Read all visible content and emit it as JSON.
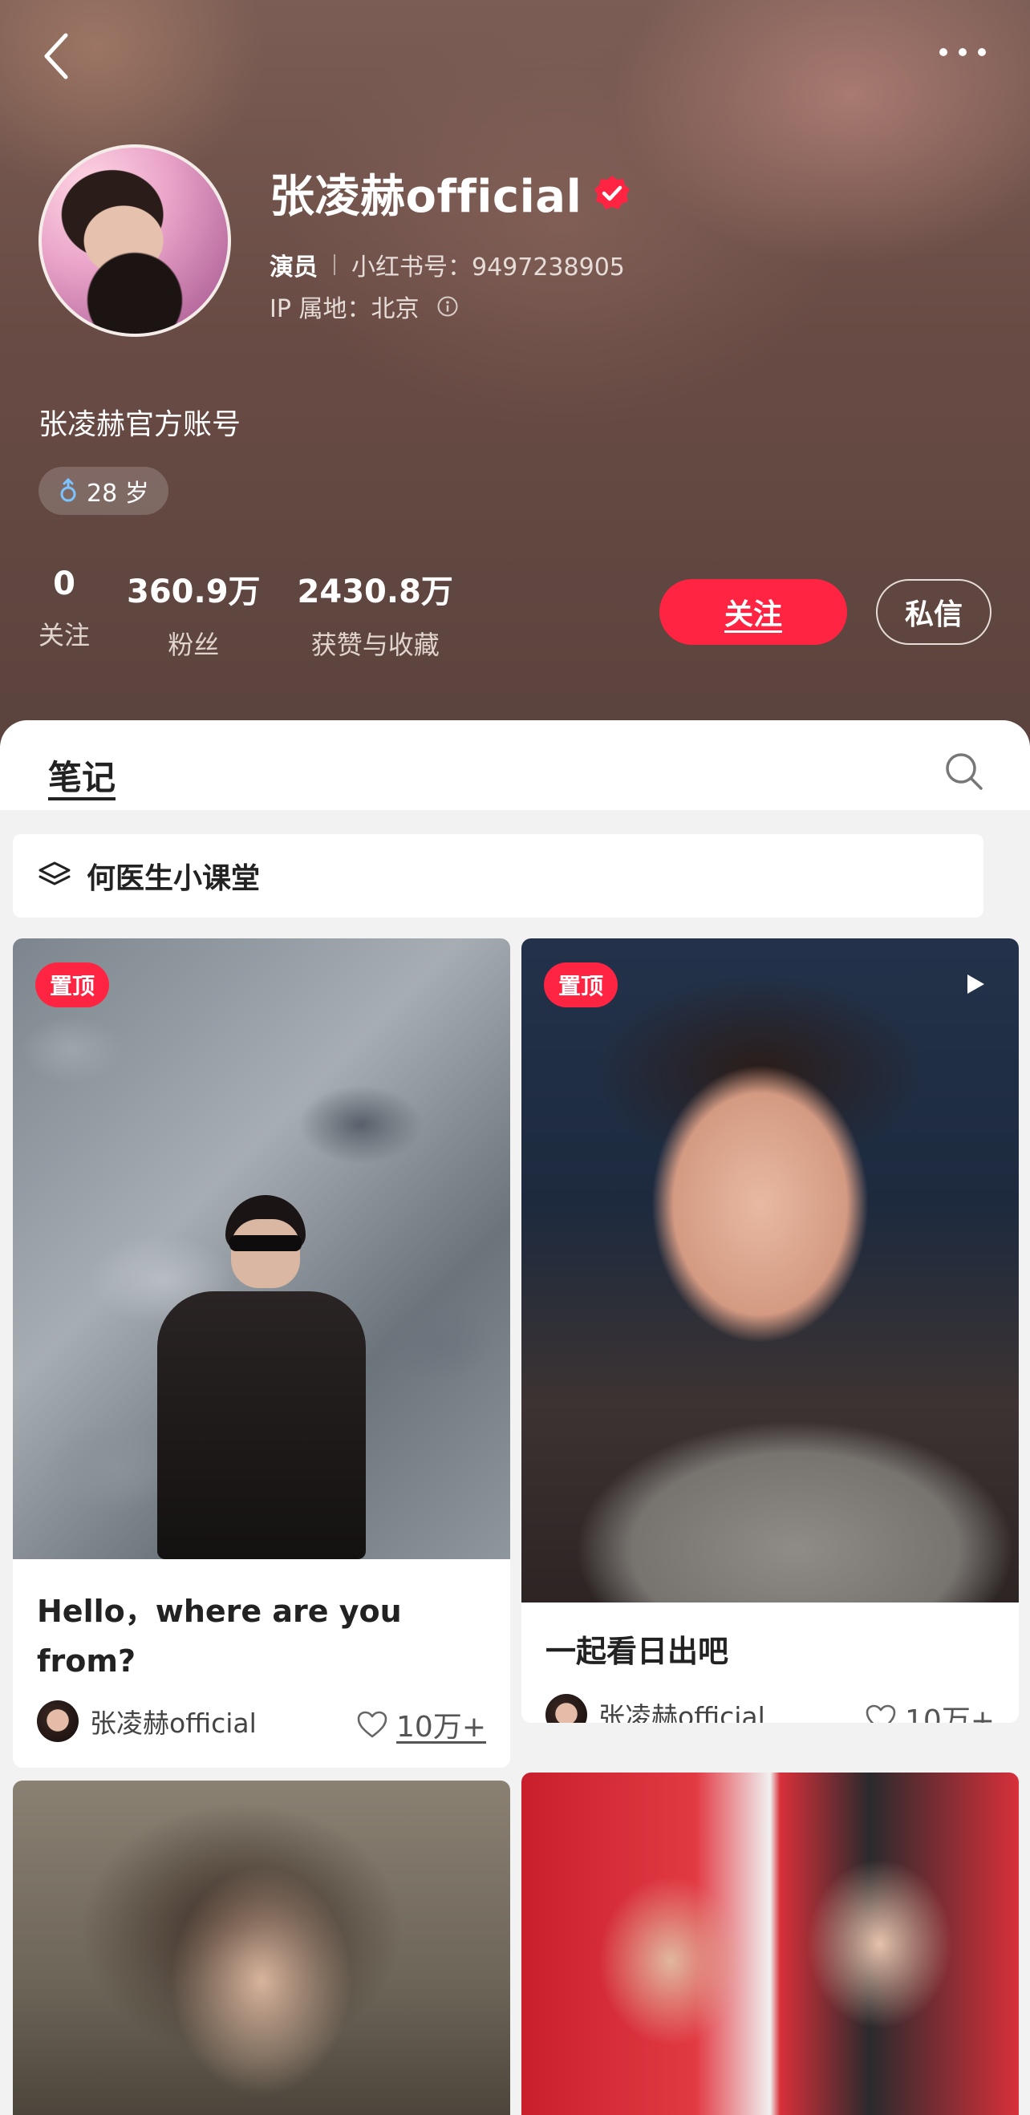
{
  "profile": {
    "name": "张凌赫official",
    "role": "演员",
    "red_id": "小红书号：9497238905",
    "ip_location": "IP 属地：北京",
    "bio": "张凌赫官方账号",
    "age": "28 岁"
  },
  "stats": [
    {
      "value": "0",
      "label": "关注"
    },
    {
      "value": "360.9万",
      "label": "粉丝"
    },
    {
      "value": "2430.8万",
      "label": "获赞与收藏"
    }
  ],
  "actions": {
    "follow": "关注",
    "message": "私信"
  },
  "tabs": {
    "notes": "笔记"
  },
  "collection": {
    "label": "何医生小课堂"
  },
  "cards": [
    {
      "pinned": "置顶",
      "title_line1": "Hello，where are you",
      "title_line2": "from?",
      "author": "张凌赫official",
      "likes": "10万+"
    },
    {
      "pinned": "置顶",
      "title_line1": "一起看日出吧",
      "author": "张凌赫official",
      "likes": "10万+",
      "video": true
    }
  ],
  "colors": {
    "accent": "#ff2442",
    "header_bg": "#684b44"
  },
  "icons": [
    "back-icon",
    "more-icon",
    "verified-icon",
    "info-icon",
    "gender-icon",
    "search-icon",
    "layers-icon",
    "play-icon",
    "heart-icon"
  ]
}
